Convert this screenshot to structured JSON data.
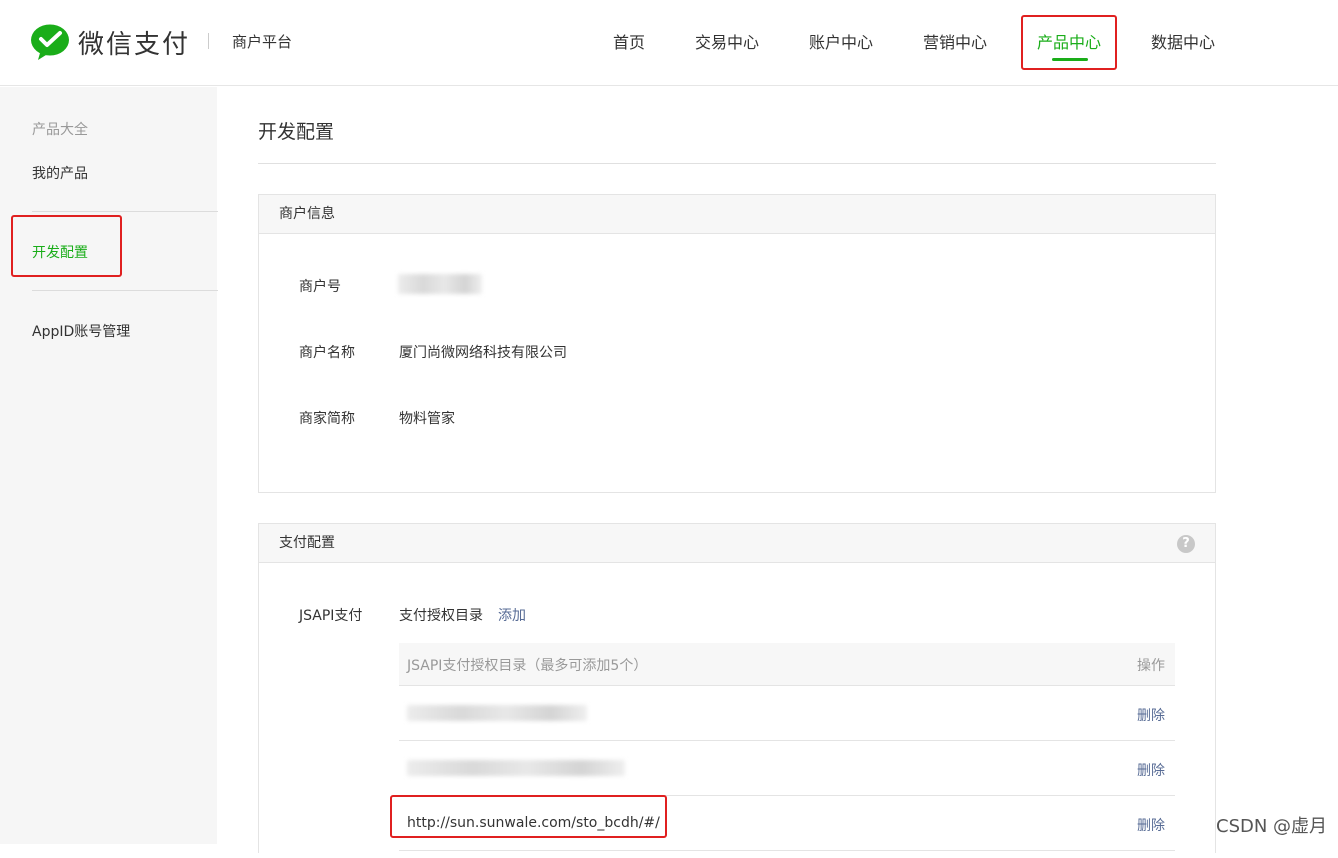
{
  "header": {
    "brand": "微信支付",
    "platform": "商户平台",
    "nav": [
      "首页",
      "交易中心",
      "账户中心",
      "营销中心",
      "产品中心",
      "数据中心"
    ],
    "active_nav": "产品中心",
    "brand_color": "#1aad19"
  },
  "sidebar": {
    "category": "产品大全",
    "items": [
      "我的产品",
      "开发配置",
      "AppID账号管理"
    ],
    "active_item": "开发配置"
  },
  "main": {
    "title": "开发配置",
    "merchant_panel": {
      "title": "商户信息",
      "rows": [
        {
          "label": "商户号",
          "value": ""
        },
        {
          "label": "商户名称",
          "value": "厦门尚微网络科技有限公司"
        },
        {
          "label": "商家简称",
          "value": "物料管家"
        }
      ]
    },
    "pay_panel": {
      "title": "支付配置",
      "help_icon": "question-circle-icon",
      "jsapi_label": "JSAPI支付",
      "auth_dir_label": "支付授权目录",
      "add_link": "添加",
      "table": {
        "col_dir": "JSAPI支付授权目录（最多可添加5个）",
        "col_op": "操作",
        "rows": [
          {
            "url": "",
            "op": "删除"
          },
          {
            "url": "",
            "op": "删除"
          },
          {
            "url": "http://sun.sunwale.com/sto_bcdh/#/",
            "op": "删除"
          }
        ]
      }
    }
  },
  "watermark": "CSDN @虚月"
}
